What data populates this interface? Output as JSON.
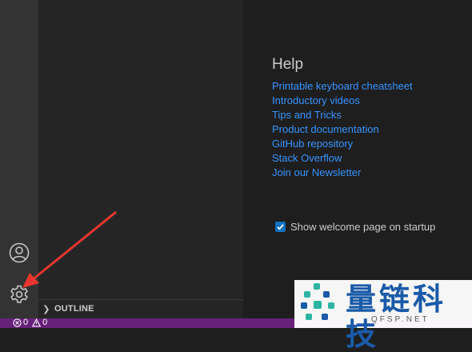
{
  "welcome": {
    "help_title": "Help",
    "help_links": [
      "Printable keyboard cheatsheet",
      "Introductory videos",
      "Tips and Tricks",
      "Product documentation",
      "GitHub repository",
      "Stack Overflow",
      "Join our Newsletter"
    ],
    "show_on_startup": {
      "label": "Show welcome page on startup",
      "checked": true
    }
  },
  "sidebar": {
    "outline_label": "OUTLINE"
  },
  "status_bar": {
    "errors": "0",
    "warnings": "0"
  },
  "watermark": {
    "brand": "量链科技",
    "url": "QFSP.NET"
  },
  "colors": {
    "activity_bar": "#333333",
    "sidebar": "#252526",
    "editor": "#1e1e1e",
    "link": "#3794ff",
    "status_bar": "#68217a",
    "annotation_arrow": "#e8362f"
  },
  "icons": [
    "account-icon",
    "gear-icon",
    "chevron-right-icon",
    "error-icon",
    "warning-icon",
    "checkmark-icon"
  ]
}
